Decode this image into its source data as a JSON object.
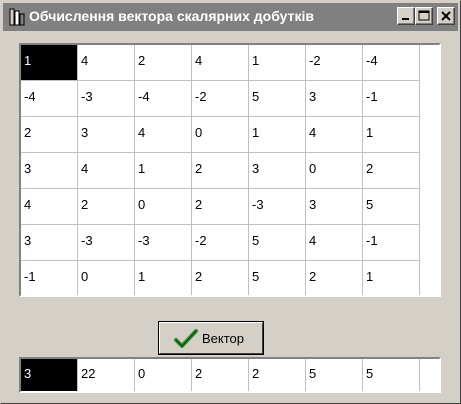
{
  "window": {
    "title": "Обчислення вектора скалярних добутків",
    "icon": "app-icon",
    "controls": [
      "minimize-icon",
      "maximize-icon",
      "close-icon"
    ]
  },
  "matrix": {
    "rows": [
      [
        "1",
        "4",
        "2",
        "4",
        "1",
        "-2",
        "-4"
      ],
      [
        "-4",
        "-3",
        "-4",
        "-2",
        "5",
        "3",
        "-1"
      ],
      [
        "2",
        "3",
        "4",
        "0",
        "1",
        "4",
        "1"
      ],
      [
        "3",
        "4",
        "1",
        "2",
        "3",
        "0",
        "2"
      ],
      [
        "4",
        "2",
        "0",
        "2",
        "-3",
        "3",
        "5"
      ],
      [
        "3",
        "-3",
        "-3",
        "-2",
        "5",
        "4",
        "-1"
      ],
      [
        "-1",
        "0",
        "1",
        "2",
        "5",
        "2",
        "1"
      ]
    ],
    "selected": [
      0,
      0
    ]
  },
  "button": {
    "label": "Вектор",
    "icon": "checkmark-icon"
  },
  "result": {
    "values": [
      "3",
      "22",
      "0",
      "2",
      "2",
      "5",
      "5"
    ],
    "selected": 0
  },
  "colors": {
    "titlebar": "#808080",
    "face": "#d4d0c8",
    "selection": "#000000",
    "checkmark": "#2f8f2f"
  }
}
